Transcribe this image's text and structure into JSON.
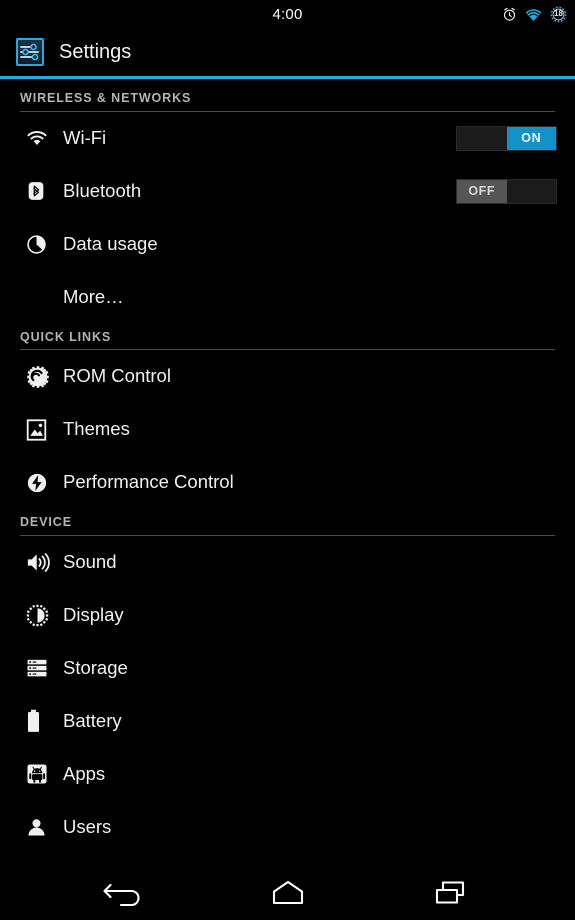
{
  "status_bar": {
    "time": "4:00",
    "icons": [
      {
        "name": "alarm-clock-icon",
        "label": "alarm"
      },
      {
        "name": "wifi-signal-icon",
        "label": "wifi"
      },
      {
        "name": "battery-level-icon",
        "label": "battery",
        "value": "18"
      }
    ],
    "battery_text": "18"
  },
  "action_bar": {
    "icon": "settings-sliders-icon",
    "title": "Settings",
    "accent_color": "#2ca7e0"
  },
  "colors": {
    "background": "#000000",
    "accent": "#2ca7e0",
    "switch_on": "#1192c8",
    "switch_off": "#555555",
    "section_header_text": "#b4b4b4",
    "divider": "#4a4a4a",
    "row_text": "#f0f0f0"
  },
  "sections": [
    {
      "header": "WIRELESS & NETWORKS",
      "rows": [
        {
          "label": "Wi-Fi",
          "icon": "wifi-icon",
          "control": "switch",
          "state": "on",
          "state_label": "ON"
        },
        {
          "label": "Bluetooth",
          "icon": "bluetooth-icon",
          "control": "switch",
          "state": "off",
          "state_label": "OFF"
        },
        {
          "label": "Data usage",
          "icon": "data-usage-pie-icon",
          "control": "none"
        },
        {
          "label": "More…",
          "icon": "none",
          "control": "none"
        }
      ]
    },
    {
      "header": "QUICK LINKS",
      "rows": [
        {
          "label": "ROM Control",
          "icon": "rom-control-gear-icon",
          "control": "none"
        },
        {
          "label": "Themes",
          "icon": "themes-picture-icon",
          "control": "none"
        },
        {
          "label": "Performance Control",
          "icon": "performance-bolt-icon",
          "control": "none"
        }
      ]
    },
    {
      "header": "DEVICE",
      "rows": [
        {
          "label": "Sound",
          "icon": "speaker-icon",
          "control": "none"
        },
        {
          "label": "Display",
          "icon": "brightness-icon",
          "control": "none"
        },
        {
          "label": "Storage",
          "icon": "storage-icon",
          "control": "none"
        },
        {
          "label": "Battery",
          "icon": "battery-icon",
          "control": "none"
        },
        {
          "label": "Apps",
          "icon": "apps-android-icon",
          "control": "none"
        },
        {
          "label": "Users",
          "icon": "users-person-icon",
          "control": "none"
        }
      ]
    }
  ],
  "nav_bar": {
    "buttons": [
      {
        "name": "back-button",
        "icon": "back-arrow-icon"
      },
      {
        "name": "home-button",
        "icon": "home-icon"
      },
      {
        "name": "recents-button",
        "icon": "recents-icon"
      }
    ]
  }
}
